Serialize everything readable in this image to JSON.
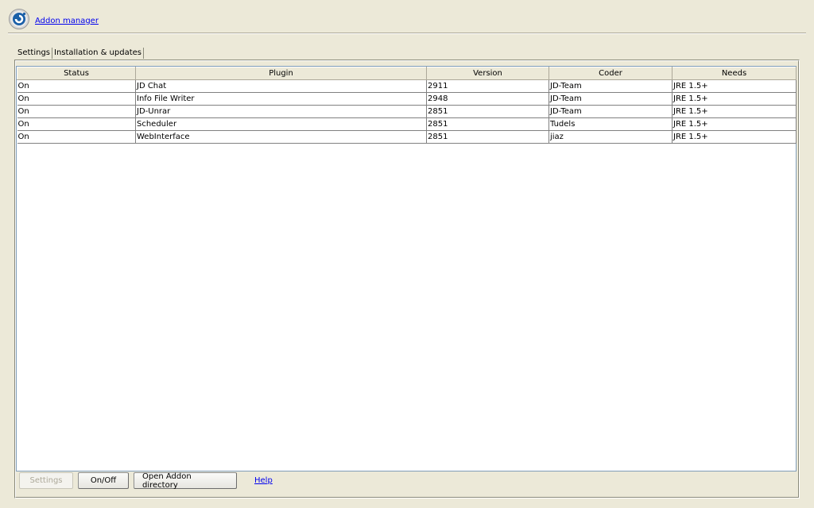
{
  "header": {
    "icon": "jdownloader-logo-icon",
    "title": "Addon manager"
  },
  "tabs": [
    {
      "label": "Settings",
      "active": true
    },
    {
      "label": "Installation & updates",
      "active": false
    }
  ],
  "table": {
    "columns": [
      "Status",
      "Plugin",
      "Version",
      "Coder",
      "Needs"
    ],
    "rows": [
      [
        "On",
        "JD Chat",
        "2911",
        "JD-Team",
        "JRE 1.5+"
      ],
      [
        "On",
        "Info File Writer",
        "2948",
        "JD-Team",
        "JRE 1.5+"
      ],
      [
        "On",
        "JD-Unrar",
        "2851",
        "JD-Team",
        "JRE 1.5+"
      ],
      [
        "On",
        "Scheduler",
        "2851",
        "Tudels",
        "JRE 1.5+"
      ],
      [
        "On",
        "WebInterface",
        "2851",
        "jiaz",
        "JRE 1.5+"
      ]
    ]
  },
  "buttons": {
    "settings": "Settings",
    "onoff": "On/Off",
    "open_dir": "Open Addon directory",
    "help": "Help"
  }
}
